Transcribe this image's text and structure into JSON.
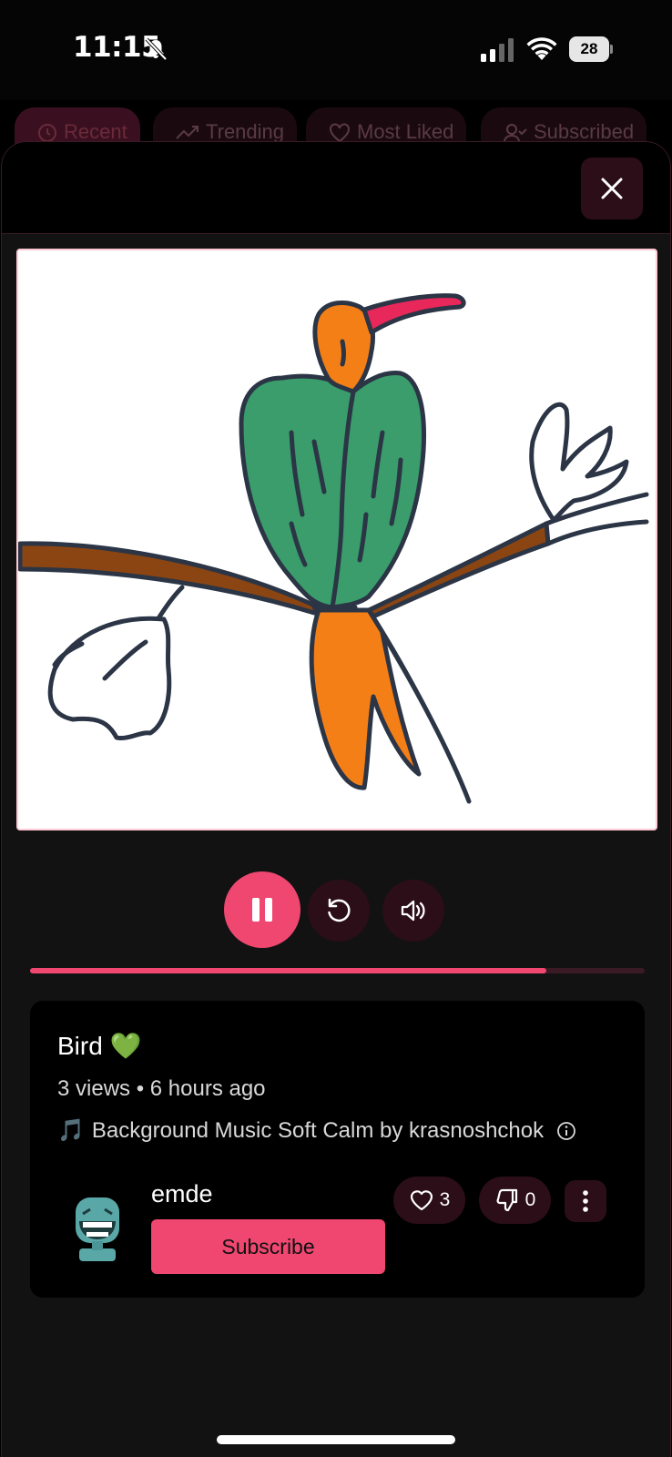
{
  "status_bar": {
    "time": "11:15",
    "battery": "28"
  },
  "background_tabs": [
    {
      "label": "Recent",
      "icon": "clock-icon"
    },
    {
      "label": "Trending",
      "icon": "trending-icon"
    },
    {
      "label": "Most Liked",
      "icon": "heart-icon"
    },
    {
      "label": "Subscribed",
      "icon": "user-check-icon"
    }
  ],
  "player": {
    "progress": 0.84,
    "pause_icon": "pause-icon",
    "replay_icon": "replay-icon",
    "volume_icon": "volume-icon"
  },
  "video": {
    "title": "Bird 💚",
    "meta": "3 views • 6 hours ago",
    "music_note": "🎵",
    "music": "Background Music Soft Calm by krasnoshchok"
  },
  "author": {
    "name": "emde",
    "subscribe_label": "Subscribe"
  },
  "reactions": {
    "likes": "3",
    "dislikes": "0"
  },
  "colors": {
    "accent": "#ef4770",
    "dark_button": "#2b0e17",
    "card": "#000000"
  }
}
